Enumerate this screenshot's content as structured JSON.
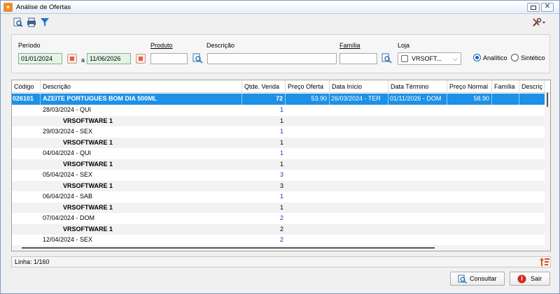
{
  "window": {
    "title": "Análise de Ofertas"
  },
  "filters": {
    "periodo_label": "Período",
    "date_from": "01/01/2024",
    "a_label": "a",
    "date_to": "11/06/2026",
    "produto_label": "Produto",
    "produto_value": "",
    "descricao_label": "Descrição",
    "descricao_value": "",
    "familia_label": "Família",
    "familia_value": "",
    "loja_label": "Loja",
    "loja_value": "VRSOFT...",
    "radio_analitico": "Analítico",
    "radio_sintetico": "Sintético",
    "selected_mode": "Analítico"
  },
  "grid": {
    "columns": [
      "Código",
      "Descrição",
      "Qtde. Venda",
      "Preço Oferta",
      "Data Início",
      "Data Término",
      "Preço Normal",
      "Família",
      "Descriç"
    ],
    "selected": {
      "codigo": "026101",
      "descricao": "AZEITE PORTUGUES BOM DIA 500ML",
      "qtde": "72",
      "preco_oferta": "53.90",
      "data_inicio": "26/03/2024 - TER",
      "data_termino": "01/11/2026 - DOM",
      "preco_normal": "58.90"
    },
    "rows": [
      {
        "desc": "28/03/2024 - QUI",
        "qty": "1",
        "kind": "date"
      },
      {
        "desc": "VRSOFTWARE 1",
        "qty": "1",
        "kind": "store"
      },
      {
        "desc": "29/03/2024 - SEX",
        "qty": "1",
        "kind": "date"
      },
      {
        "desc": "VRSOFTWARE 1",
        "qty": "1",
        "kind": "store"
      },
      {
        "desc": "04/04/2024 - QUI",
        "qty": "1",
        "kind": "date"
      },
      {
        "desc": "VRSOFTWARE 1",
        "qty": "1",
        "kind": "store"
      },
      {
        "desc": "05/04/2024 - SEX",
        "qty": "3",
        "kind": "date"
      },
      {
        "desc": "VRSOFTWARE 1",
        "qty": "3",
        "kind": "store"
      },
      {
        "desc": "06/04/2024 - SAB",
        "qty": "1",
        "kind": "date"
      },
      {
        "desc": "VRSOFTWARE 1",
        "qty": "1",
        "kind": "store"
      },
      {
        "desc": "07/04/2024 - DOM",
        "qty": "2",
        "kind": "date"
      },
      {
        "desc": "VRSOFTWARE 1",
        "qty": "2",
        "kind": "store"
      },
      {
        "desc": "12/04/2024 - SEX",
        "qty": "2",
        "kind": "date"
      }
    ]
  },
  "status": {
    "text": "Linha: 1/160"
  },
  "buttons": {
    "consultar": "Consultar",
    "sair": "Sair"
  },
  "colors": {
    "selection": "#1e90e6",
    "date_qty": "#1a37c8",
    "date_field": "#e4f5e8"
  }
}
